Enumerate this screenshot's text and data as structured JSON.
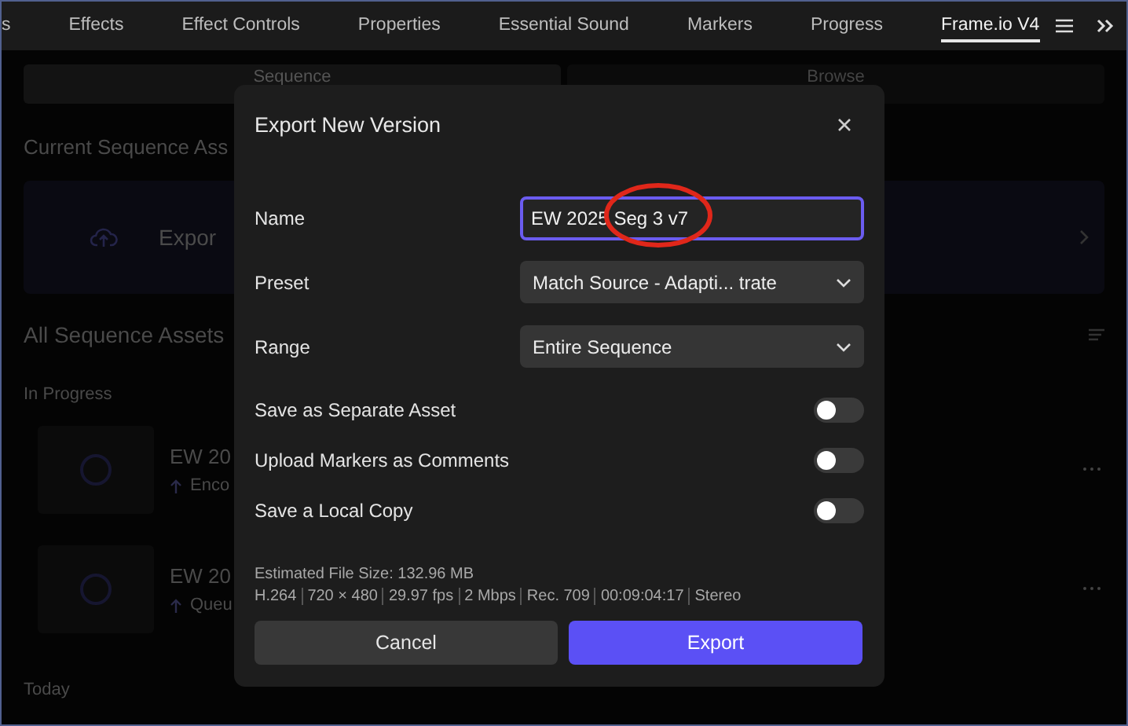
{
  "tabs": [
    {
      "label": "s",
      "selected": false
    },
    {
      "label": "Effects",
      "selected": false
    },
    {
      "label": "Effect Controls",
      "selected": false
    },
    {
      "label": "Properties",
      "selected": false
    },
    {
      "label": "Essential Sound",
      "selected": false
    },
    {
      "label": "Markers",
      "selected": false
    },
    {
      "label": "Progress",
      "selected": false
    },
    {
      "label": "Frame.io V4",
      "selected": true
    }
  ],
  "panel": {
    "view_switch": [
      {
        "label": "Sequence",
        "selected": true
      },
      {
        "label": "Browse",
        "selected": false
      }
    ],
    "current_heading": "Current Sequence Ass",
    "export_card": "Expor",
    "all_heading": "All Sequence Assets",
    "in_progress": "In Progress",
    "assets": [
      {
        "name": "EW 20",
        "status": "Enco"
      },
      {
        "name": "EW 20",
        "status": "Queu"
      }
    ],
    "today": "Today"
  },
  "dialog": {
    "title": "Export New Version",
    "fields": [
      {
        "kind": "text",
        "label": "Name",
        "value": "EW 2025 Seg 3 v7"
      },
      {
        "kind": "select",
        "label": "Preset",
        "value": "Match Source - Adapti... trate"
      },
      {
        "kind": "select",
        "label": "Range",
        "value": "Entire Sequence"
      }
    ],
    "toggles": [
      {
        "label": "Save as Separate Asset",
        "on": false
      },
      {
        "label": "Upload Markers as Comments",
        "on": false
      },
      {
        "label": "Save a Local Copy",
        "on": false
      }
    ],
    "estimate": "Estimated File Size: 132.96 MB",
    "specs": [
      "H.264",
      "720 × 480",
      "29.97 fps",
      "2 Mbps",
      "Rec. 709",
      "00:09:04:17",
      "Stereo"
    ],
    "buttons": [
      {
        "label": "Cancel",
        "kind": "secondary"
      },
      {
        "label": "Export",
        "kind": "primary"
      }
    ]
  }
}
